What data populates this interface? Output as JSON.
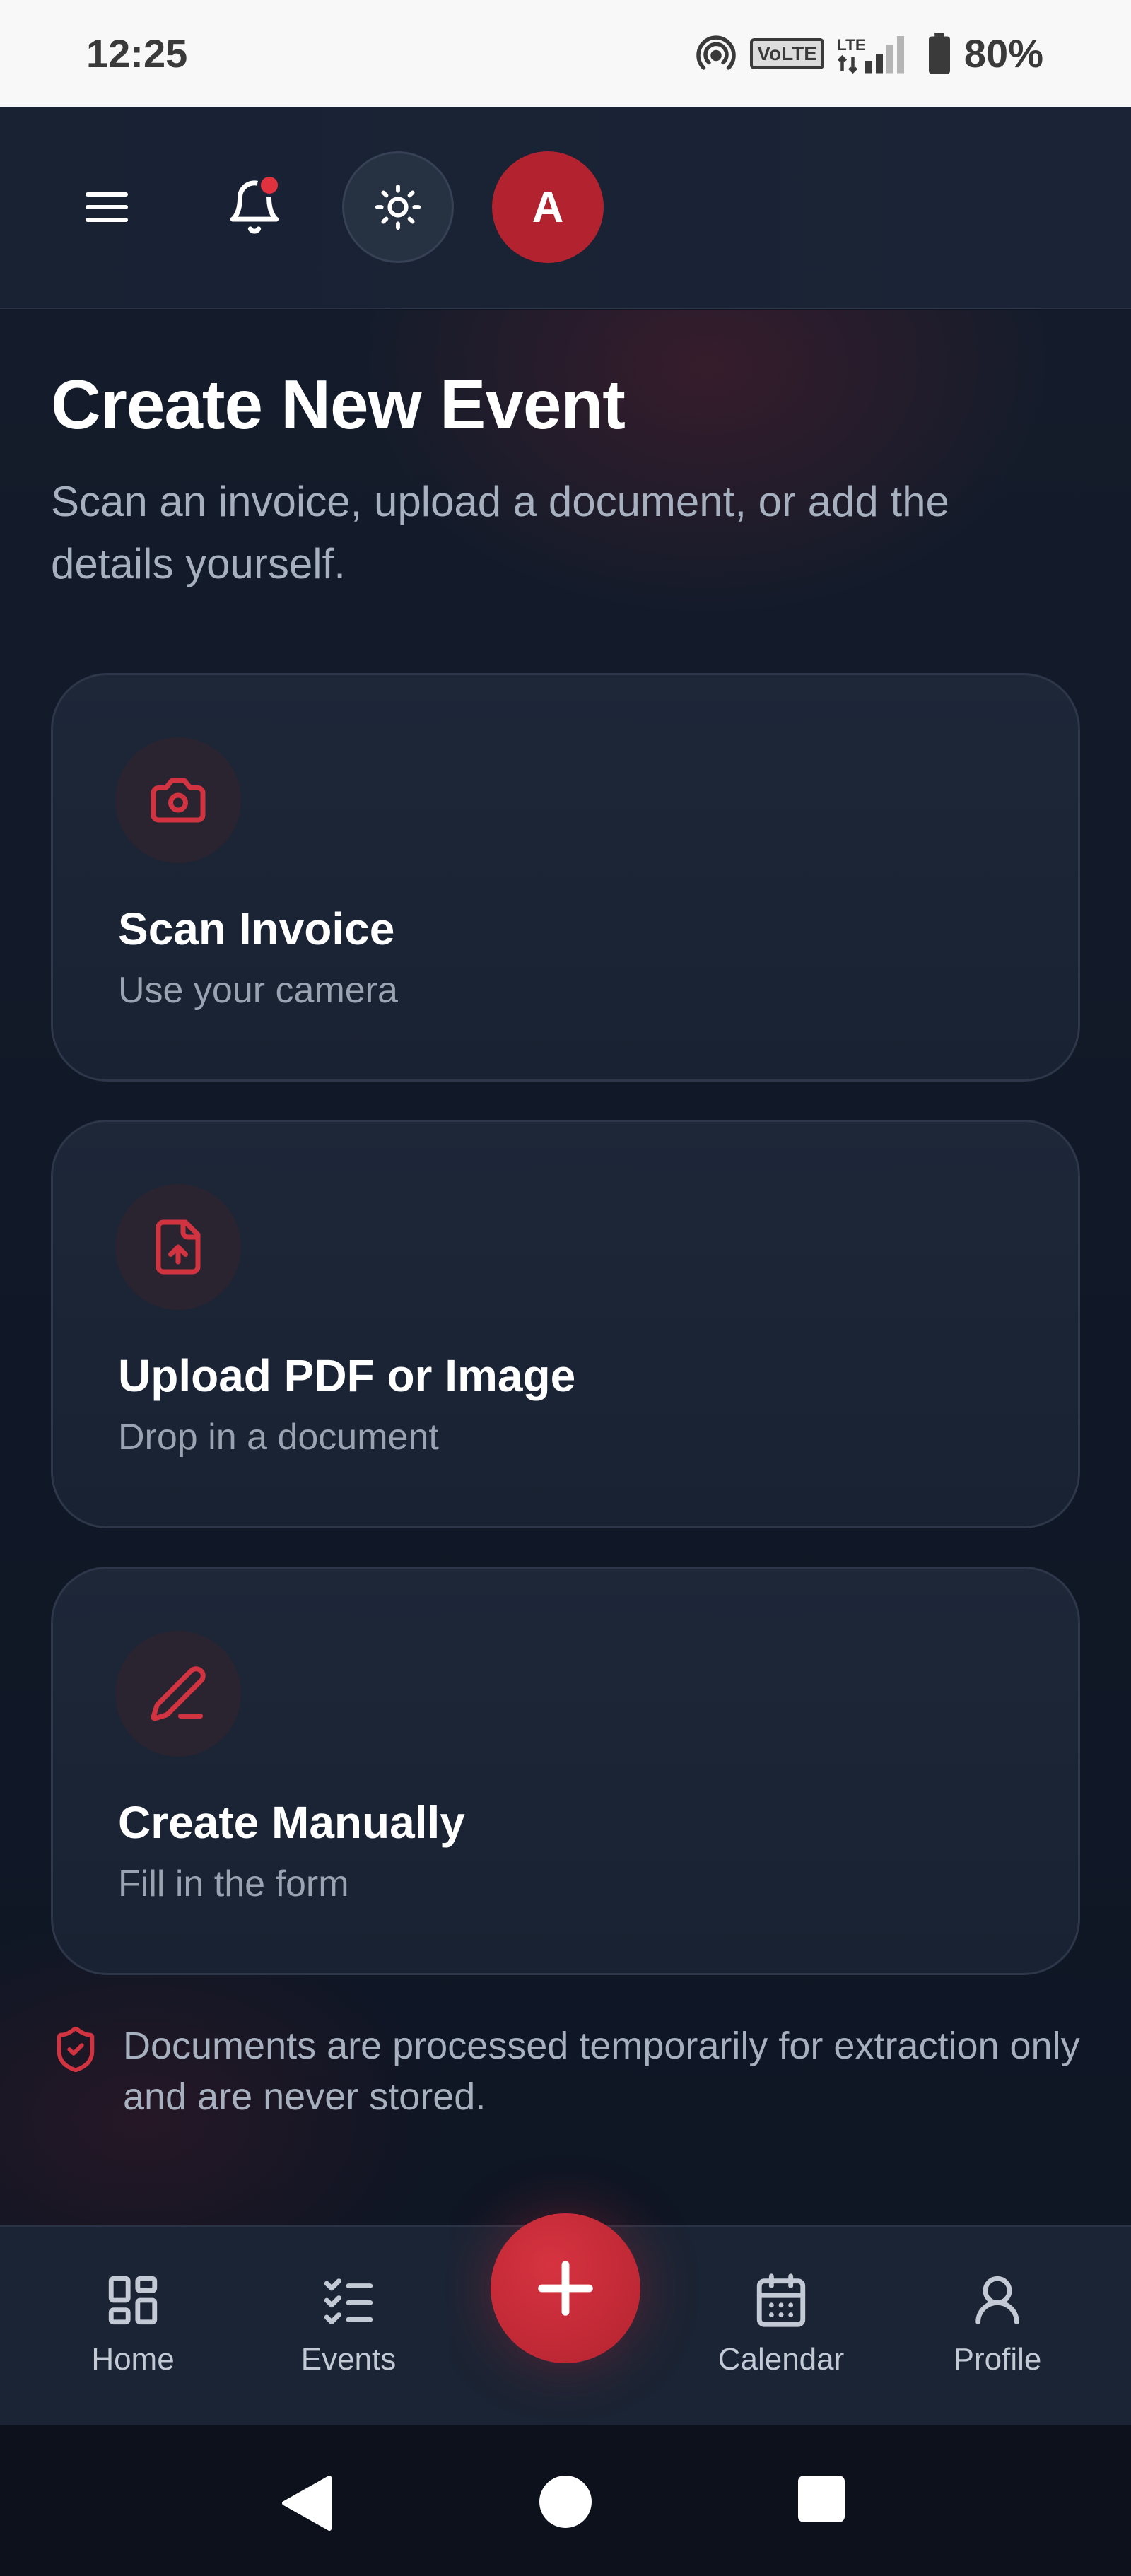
{
  "status_bar": {
    "time": "12:25",
    "network": "VoLTE",
    "signal_type": "LTE",
    "battery": "80%"
  },
  "header": {
    "menu_icon": "hamburger-menu-icon",
    "bell_icon": "bell-icon",
    "has_notification": true,
    "theme_icon": "sun-icon",
    "avatar_letter": "A"
  },
  "page": {
    "title": "Create New Event",
    "subtitle": "Scan an invoice, upload a document, or add the details yourself."
  },
  "options": [
    {
      "icon": "camera-icon",
      "title": "Scan Invoice",
      "description": "Use your camera"
    },
    {
      "icon": "file-upload-icon",
      "title": "Upload PDF or Image",
      "description": "Drop in a document"
    },
    {
      "icon": "pencil-icon",
      "title": "Create Manually",
      "description": "Fill in the form"
    }
  ],
  "notice": {
    "icon": "shield-check-icon",
    "text": "Documents are processed temporarily for extraction only and are never stored."
  },
  "bottom_nav": {
    "items": [
      {
        "icon": "grid-icon",
        "label": "Home"
      },
      {
        "icon": "checklist-icon",
        "label": "Events"
      },
      {
        "icon": "calendar-icon",
        "label": "Calendar"
      },
      {
        "icon": "user-icon",
        "label": "Profile"
      }
    ],
    "fab_icon": "plus-icon"
  },
  "colors": {
    "accent": "#c42b38",
    "background": "#101827",
    "card": "#1c2637",
    "muted_text": "#a7b0bf"
  }
}
